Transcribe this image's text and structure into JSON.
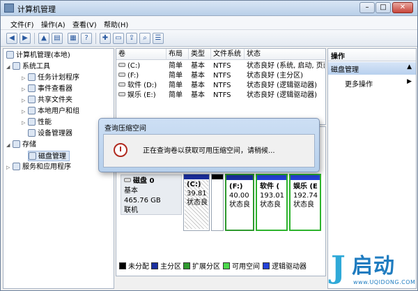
{
  "window": {
    "title": "计算机管理"
  },
  "menu": [
    "文件(F)",
    "操作(A)",
    "查看(V)",
    "帮助(H)"
  ],
  "toolbar": {
    "icons": [
      "back-icon",
      "forward-icon",
      "up-icon",
      "show-hide-tree-icon",
      "properties-icon",
      "help-icon",
      "new-icon",
      "open-icon",
      "search-icon",
      "list-view-icon"
    ]
  },
  "tree": {
    "root": "计算机管理(本地)",
    "system_tools": "系统工具",
    "task_scheduler": "任务计划程序",
    "event_viewer": "事件查看器",
    "shared_folders": "共享文件夹",
    "local_users": "本地用户和组",
    "performance": "性能",
    "device_manager": "设备管理器",
    "storage": "存储",
    "disk_management": "磁盘管理",
    "services": "服务和应用程序"
  },
  "volumes": {
    "headers": [
      "卷",
      "布局",
      "类型",
      "文件系统",
      "状态"
    ],
    "rows": [
      {
        "vol": "(C:)",
        "layout": "简单",
        "type": "基本",
        "fs": "NTFS",
        "status": "状态良好 (系统, 启动, 页面"
      },
      {
        "vol": "(F:)",
        "layout": "简单",
        "type": "基本",
        "fs": "NTFS",
        "status": "状态良好 (主分区)"
      },
      {
        "vol": "软件 (D:)",
        "layout": "简单",
        "type": "基本",
        "fs": "NTFS",
        "status": "状态良好 (逻辑驱动器)"
      },
      {
        "vol": "娱乐 (E:)",
        "layout": "简单",
        "type": "基本",
        "fs": "NTFS",
        "status": "状态良好 (逻辑驱动器)"
      }
    ]
  },
  "disk": {
    "name": "磁盘 0",
    "type": "基本",
    "size": "465.76 GB",
    "status": "联机",
    "partitions": [
      {
        "title": "(C:)",
        "size": "39.81",
        "status": "状态良"
      },
      {
        "title": "",
        "size": "",
        "status": ""
      },
      {
        "title": "(F:)",
        "size": "40.00",
        "status": "状态良"
      },
      {
        "title": "软件 (",
        "size": "193.01",
        "status": "状态良"
      },
      {
        "title": "娱乐 (E",
        "size": "192.74",
        "status": "状态良"
      }
    ]
  },
  "legend": [
    {
      "label": "未分配",
      "color": "#000000"
    },
    {
      "label": "主分区",
      "color": "#1a2f9f"
    },
    {
      "label": "扩展分区",
      "color": "#2e9a2e"
    },
    {
      "label": "可用空间",
      "color": "#4cd94c"
    },
    {
      "label": "逻辑驱动器",
      "color": "#2442d8"
    }
  ],
  "actions": {
    "header": "操作",
    "section": "磁盘管理",
    "more": "更多操作"
  },
  "dialog": {
    "title": "查询压缩空间",
    "message": "正在查询卷以获取可用压缩空间，请稍候..."
  },
  "watermark": {
    "brand": "启动",
    "url": "www.UQIDONG.COM"
  }
}
